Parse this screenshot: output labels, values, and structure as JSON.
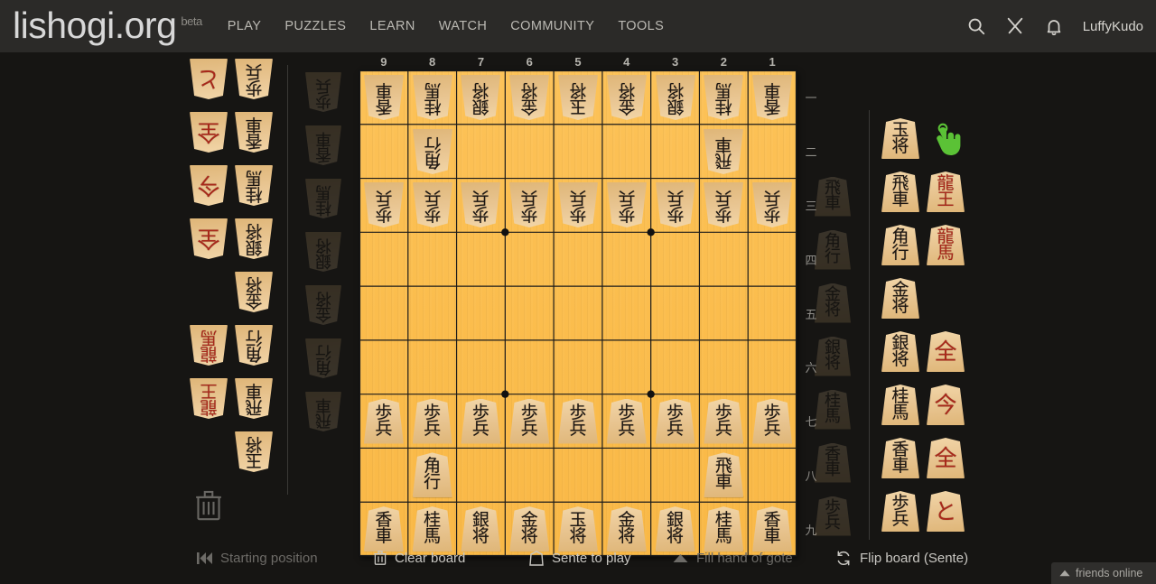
{
  "header": {
    "site_title": "lishogi.org",
    "beta_label": "beta",
    "nav": [
      {
        "label": "PLAY",
        "name": "nav-play"
      },
      {
        "label": "PUZZLES",
        "name": "nav-puzzles"
      },
      {
        "label": "LEARN",
        "name": "nav-learn"
      },
      {
        "label": "WATCH",
        "name": "nav-watch"
      },
      {
        "label": "COMMUNITY",
        "name": "nav-community"
      },
      {
        "label": "TOOLS",
        "name": "nav-tools"
      }
    ],
    "icons": [
      "search-icon",
      "challenge-swords-icon",
      "notification-bell-icon"
    ],
    "username": "LuffyKudo"
  },
  "board": {
    "file_labels": [
      "9",
      "8",
      "7",
      "6",
      "5",
      "4",
      "3",
      "2",
      "1"
    ],
    "rank_labels": [
      "一",
      "二",
      "三",
      "四",
      "五",
      "六",
      "七",
      "八",
      "九"
    ],
    "board_color": "#fbbd4d",
    "grid_line_color": "#1a1a1a",
    "star_points": [
      [
        3,
        3
      ],
      [
        3,
        6
      ],
      [
        6,
        3
      ],
      [
        6,
        6
      ]
    ],
    "rows": [
      [
        {
          "ch": [
            "香",
            "車"
          ],
          "side": "gote",
          "promoted": false
        },
        {
          "ch": [
            "桂",
            "馬"
          ],
          "side": "gote",
          "promoted": false
        },
        {
          "ch": [
            "銀",
            "将"
          ],
          "side": "gote",
          "promoted": false
        },
        {
          "ch": [
            "金",
            "将"
          ],
          "side": "gote",
          "promoted": false
        },
        {
          "ch": [
            "玉",
            "将"
          ],
          "side": "gote",
          "promoted": false
        },
        {
          "ch": [
            "金",
            "将"
          ],
          "side": "gote",
          "promoted": false
        },
        {
          "ch": [
            "銀",
            "将"
          ],
          "side": "gote",
          "promoted": false
        },
        {
          "ch": [
            "桂",
            "馬"
          ],
          "side": "gote",
          "promoted": false
        },
        {
          "ch": [
            "香",
            "車"
          ],
          "side": "gote",
          "promoted": false
        }
      ],
      [
        null,
        {
          "ch": [
            "角",
            "行"
          ],
          "side": "gote",
          "promoted": false
        },
        null,
        null,
        null,
        null,
        null,
        {
          "ch": [
            "飛",
            "車"
          ],
          "side": "gote",
          "promoted": false
        },
        null
      ],
      [
        {
          "ch": [
            "歩",
            "兵"
          ],
          "side": "gote",
          "promoted": false
        },
        {
          "ch": [
            "歩",
            "兵"
          ],
          "side": "gote",
          "promoted": false
        },
        {
          "ch": [
            "歩",
            "兵"
          ],
          "side": "gote",
          "promoted": false
        },
        {
          "ch": [
            "歩",
            "兵"
          ],
          "side": "gote",
          "promoted": false
        },
        {
          "ch": [
            "歩",
            "兵"
          ],
          "side": "gote",
          "promoted": false
        },
        {
          "ch": [
            "歩",
            "兵"
          ],
          "side": "gote",
          "promoted": false
        },
        {
          "ch": [
            "歩",
            "兵"
          ],
          "side": "gote",
          "promoted": false
        },
        {
          "ch": [
            "歩",
            "兵"
          ],
          "side": "gote",
          "promoted": false
        },
        {
          "ch": [
            "歩",
            "兵"
          ],
          "side": "gote",
          "promoted": false
        }
      ],
      [
        null,
        null,
        null,
        null,
        null,
        null,
        null,
        null,
        null
      ],
      [
        null,
        null,
        null,
        null,
        null,
        null,
        null,
        null,
        null
      ],
      [
        null,
        null,
        null,
        null,
        null,
        null,
        null,
        null,
        null
      ],
      [
        {
          "ch": [
            "歩",
            "兵"
          ],
          "side": "sente",
          "promoted": false
        },
        {
          "ch": [
            "歩",
            "兵"
          ],
          "side": "sente",
          "promoted": false
        },
        {
          "ch": [
            "歩",
            "兵"
          ],
          "side": "sente",
          "promoted": false
        },
        {
          "ch": [
            "歩",
            "兵"
          ],
          "side": "sente",
          "promoted": false
        },
        {
          "ch": [
            "歩",
            "兵"
          ],
          "side": "sente",
          "promoted": false
        },
        {
          "ch": [
            "歩",
            "兵"
          ],
          "side": "sente",
          "promoted": false
        },
        {
          "ch": [
            "歩",
            "兵"
          ],
          "side": "sente",
          "promoted": false
        },
        {
          "ch": [
            "歩",
            "兵"
          ],
          "side": "sente",
          "promoted": false
        },
        {
          "ch": [
            "歩",
            "兵"
          ],
          "side": "sente",
          "promoted": false
        }
      ],
      [
        null,
        {
          "ch": [
            "角",
            "行"
          ],
          "side": "sente",
          "promoted": false
        },
        null,
        null,
        null,
        null,
        null,
        {
          "ch": [
            "飛",
            "車"
          ],
          "side": "sente",
          "promoted": false
        },
        null
      ],
      [
        {
          "ch": [
            "香",
            "車"
          ],
          "side": "sente",
          "promoted": false
        },
        {
          "ch": [
            "桂",
            "馬"
          ],
          "side": "sente",
          "promoted": false
        },
        {
          "ch": [
            "銀",
            "将"
          ],
          "side": "sente",
          "promoted": false
        },
        {
          "ch": [
            "金",
            "将"
          ],
          "side": "sente",
          "promoted": false
        },
        {
          "ch": [
            "玉",
            "将"
          ],
          "side": "sente",
          "promoted": false
        },
        {
          "ch": [
            "金",
            "将"
          ],
          "side": "sente",
          "promoted": false
        },
        {
          "ch": [
            "銀",
            "将"
          ],
          "side": "sente",
          "promoted": false
        },
        {
          "ch": [
            "桂",
            "馬"
          ],
          "side": "sente",
          "promoted": false
        },
        {
          "ch": [
            "香",
            "車"
          ],
          "side": "sente",
          "promoted": false
        }
      ]
    ]
  },
  "gote_palette": {
    "promoted_column": [
      {
        "ch": [
          "と"
        ],
        "promoted": true,
        "name": "palette-gote-tokin"
      },
      {
        "ch": [
          "全"
        ],
        "promoted": true,
        "name": "palette-gote-promoted-lance"
      },
      {
        "ch": [
          "今"
        ],
        "promoted": true,
        "name": "palette-gote-promoted-knight"
      },
      {
        "ch": [
          "全"
        ],
        "promoted": true,
        "name": "palette-gote-promoted-silver"
      },
      null,
      {
        "ch": [
          "龍",
          "馬"
        ],
        "promoted": true,
        "name": "palette-gote-dragon-horse"
      },
      {
        "ch": [
          "龍",
          "王"
        ],
        "promoted": true,
        "name": "palette-gote-dragon-king"
      },
      null
    ],
    "base_column": [
      {
        "ch": [
          "歩",
          "兵"
        ],
        "promoted": false,
        "name": "palette-gote-pawn"
      },
      {
        "ch": [
          "香",
          "車"
        ],
        "promoted": false,
        "name": "palette-gote-lance"
      },
      {
        "ch": [
          "桂",
          "馬"
        ],
        "promoted": false,
        "name": "palette-gote-knight"
      },
      {
        "ch": [
          "銀",
          "将"
        ],
        "promoted": false,
        "name": "palette-gote-silver"
      },
      {
        "ch": [
          "金",
          "将"
        ],
        "promoted": false,
        "name": "palette-gote-gold"
      },
      {
        "ch": [
          "角",
          "行"
        ],
        "promoted": false,
        "name": "palette-gote-bishop"
      },
      {
        "ch": [
          "飛",
          "車"
        ],
        "promoted": false,
        "name": "palette-gote-rook"
      },
      {
        "ch": [
          "玉",
          "将"
        ],
        "promoted": false,
        "name": "palette-gote-king"
      }
    ],
    "trash_icon": "trash-icon"
  },
  "sente_palette": {
    "base_column": [
      {
        "ch": [
          "玉",
          "将"
        ],
        "promoted": false,
        "name": "palette-sente-king"
      },
      {
        "ch": [
          "飛",
          "車"
        ],
        "promoted": false,
        "name": "palette-sente-rook"
      },
      {
        "ch": [
          "角",
          "行"
        ],
        "promoted": false,
        "name": "palette-sente-bishop"
      },
      {
        "ch": [
          "金",
          "将"
        ],
        "promoted": false,
        "name": "palette-sente-gold"
      },
      {
        "ch": [
          "銀",
          "将"
        ],
        "promoted": false,
        "name": "palette-sente-silver"
      },
      {
        "ch": [
          "桂",
          "馬"
        ],
        "promoted": false,
        "name": "palette-sente-knight"
      },
      {
        "ch": [
          "香",
          "車"
        ],
        "promoted": false,
        "name": "palette-sente-lance"
      },
      {
        "ch": [
          "歩",
          "兵"
        ],
        "promoted": false,
        "name": "palette-sente-pawn"
      }
    ],
    "promoted_column": [
      null,
      {
        "ch": [
          "龍",
          "王"
        ],
        "promoted": true,
        "name": "palette-sente-dragon-king"
      },
      {
        "ch": [
          "龍",
          "馬"
        ],
        "promoted": true,
        "name": "palette-sente-dragon-horse"
      },
      null,
      {
        "ch": [
          "全"
        ],
        "promoted": true,
        "name": "palette-sente-promoted-silver"
      },
      {
        "ch": [
          "今"
        ],
        "promoted": true,
        "name": "palette-sente-promoted-knight"
      },
      {
        "ch": [
          "全"
        ],
        "promoted": true,
        "name": "palette-sente-promoted-lance"
      },
      {
        "ch": [
          "と"
        ],
        "promoted": true,
        "name": "palette-sente-tokin"
      }
    ],
    "cursor_icon": "hand-cursor-icon",
    "cursor_color": "#5bc236"
  },
  "gote_hand": {
    "pieces": [
      {
        "ch": [
          "歩",
          "兵"
        ],
        "name": "gote-hand-pawn"
      },
      {
        "ch": [
          "香",
          "車"
        ],
        "name": "gote-hand-lance"
      },
      {
        "ch": [
          "桂",
          "馬"
        ],
        "name": "gote-hand-knight"
      },
      {
        "ch": [
          "銀",
          "将"
        ],
        "name": "gote-hand-silver"
      },
      {
        "ch": [
          "金",
          "将"
        ],
        "name": "gote-hand-gold"
      },
      {
        "ch": [
          "角",
          "行"
        ],
        "name": "gote-hand-bishop"
      },
      {
        "ch": [
          "飛",
          "車"
        ],
        "name": "gote-hand-rook"
      }
    ]
  },
  "sente_hand": {
    "pieces": [
      {
        "ch": [
          "飛",
          "車"
        ],
        "name": "sente-hand-rook"
      },
      {
        "ch": [
          "角",
          "行"
        ],
        "name": "sente-hand-bishop"
      },
      {
        "ch": [
          "金",
          "将"
        ],
        "name": "sente-hand-gold"
      },
      {
        "ch": [
          "銀",
          "将"
        ],
        "name": "sente-hand-silver"
      },
      {
        "ch": [
          "桂",
          "馬"
        ],
        "name": "sente-hand-knight"
      },
      {
        "ch": [
          "香",
          "車"
        ],
        "name": "sente-hand-lance"
      },
      {
        "ch": [
          "歩",
          "兵"
        ],
        "name": "sente-hand-pawn"
      }
    ]
  },
  "toolbar": {
    "starting_position": "Starting position",
    "clear_board": "Clear board",
    "turn_to_play": "Sente to play",
    "fill_hand": "Fill hand of gote",
    "flip_board": "Flip board (Sente)"
  },
  "friends": {
    "label": "friends online"
  }
}
